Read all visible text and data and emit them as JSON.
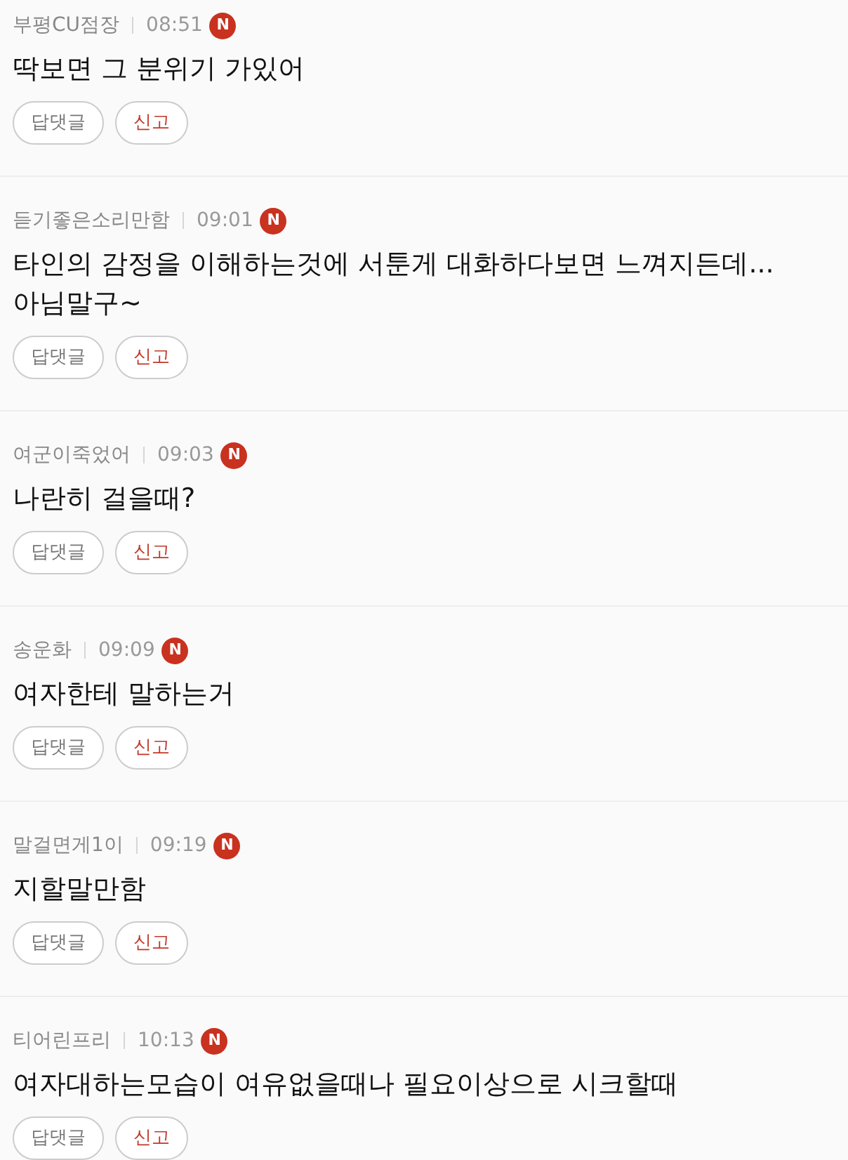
{
  "comments": [
    {
      "author": "부평CU점장",
      "time": "08:51",
      "badge": "N",
      "text": "딱보면 그 분위기 가있어",
      "buttons": [
        "답댓글",
        "신고"
      ]
    },
    {
      "author": "듣기좋은소리만함",
      "time": "09:01",
      "badge": "N",
      "text": "타인의 감정을 이해하는것에 서툰게 대화하다보면 느껴지든데... 아님말구~",
      "buttons": [
        "답댓글",
        "신고"
      ]
    },
    {
      "author": "여군이죽었어",
      "time": "09:03",
      "badge": "N",
      "text": "나란히 걸을때?",
      "buttons": [
        "답댓글",
        "신고"
      ]
    },
    {
      "author": "송운화",
      "time": "09:09",
      "badge": "N",
      "text": "여자한테 말하는거",
      "buttons": [
        "답댓글",
        "신고"
      ]
    },
    {
      "author": "말걸면게1이",
      "time": "09:19",
      "badge": "N",
      "text": "지할말만함",
      "buttons": [
        "답댓글",
        "신고"
      ]
    },
    {
      "author": "티어린프리",
      "time": "10:13",
      "badge": "N",
      "text": "여자대하는모습이 여유없을때나 필요이상으로 시크할때",
      "buttons": [
        "답댓글",
        "신고"
      ]
    }
  ]
}
